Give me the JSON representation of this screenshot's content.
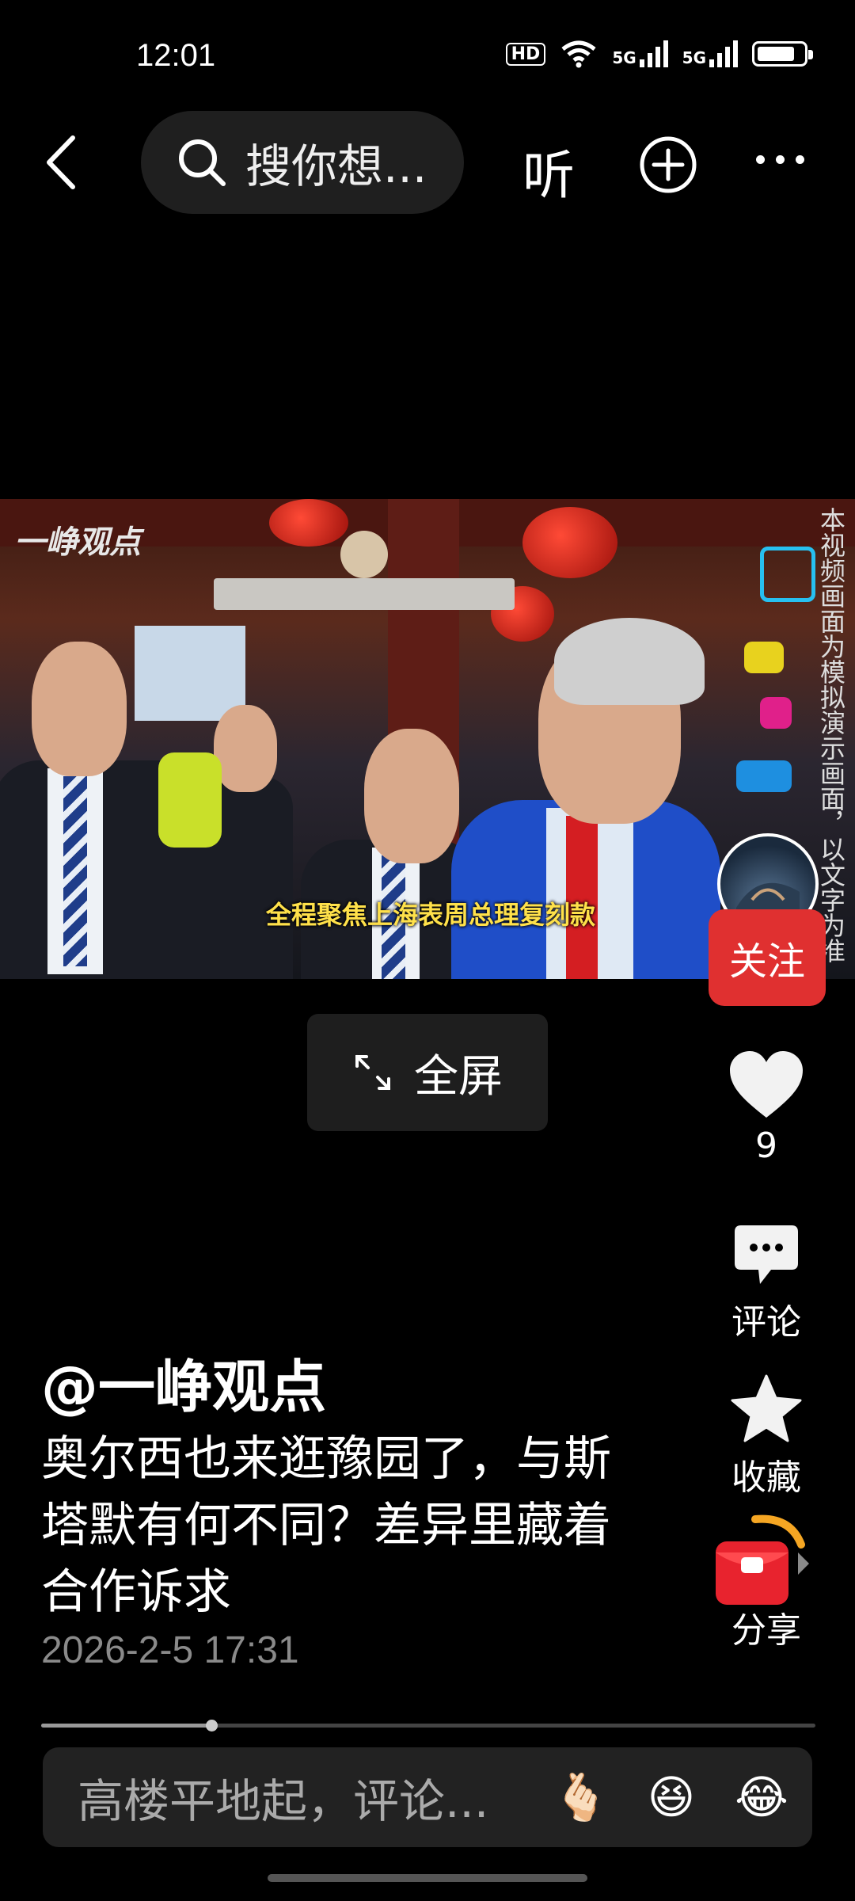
{
  "status_bar": {
    "time": "12:01",
    "hd_label": "HD",
    "network_1": "5G",
    "network_2": "5G"
  },
  "top_bar": {
    "search_placeholder": "搜你想...",
    "listen_label": "听"
  },
  "video": {
    "watermark": "一峥观点",
    "caption": "全程聚焦上海表周总理复刻款",
    "disclaimer": "本视频画面为模拟演示画面，以文字为准"
  },
  "follow_label": "关注",
  "fullscreen_label": "全屏",
  "actions": {
    "like_count": "9",
    "comment_label": "评论",
    "favorite_label": "收藏",
    "share_label": "分享"
  },
  "post": {
    "author": "@一峥观点",
    "title": "奥尔西也来逛豫园了，与斯塔默有何不同？差异里藏着合作诉求",
    "time": "2026-2-5 17:31",
    "progress": 0.22
  },
  "comment_bar": {
    "placeholder": "高楼平地起，评论...",
    "emojis": [
      "🫰🏻",
      "😆",
      "😂"
    ]
  },
  "colors": {
    "accent": "#e03030",
    "caption": "#ffe14a",
    "background": "#000000"
  }
}
